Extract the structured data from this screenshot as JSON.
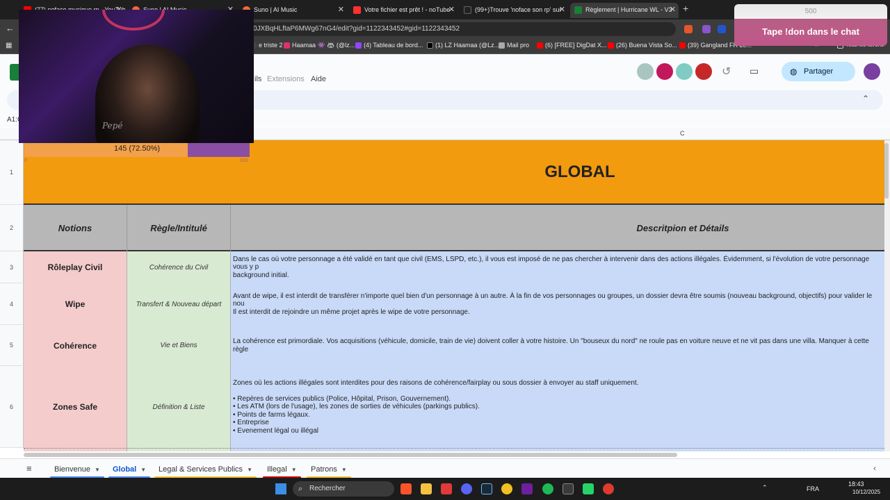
{
  "browser": {
    "tabs": [
      {
        "title": "(77) noface musique rp - YouTube",
        "color": "#ff0000"
      },
      {
        "title": "Suno | AI Music",
        "color": "#f06a3c"
      },
      {
        "title": "Suno | AI Music",
        "color": "#f06a3c"
      },
      {
        "title": "Votre fichier est prêt ! - noTube",
        "color": "#ff3030"
      },
      {
        "title": "(99+)Trouve 'noface son rp' sur",
        "color": "#222222"
      },
      {
        "title": "Règlement | Hurricane WL - V3",
        "color": "#188038"
      }
    ],
    "url": "0JXBqHLftaP6MWg67nG4/edit?gid=1122343452#gid=1122343452",
    "bookmarks": [
      {
        "label": "e triste 2",
        "color": "#444444"
      },
      {
        "label": "Haamaa 👾 🦝 (@lz...",
        "color": "#e1306c"
      },
      {
        "label": "(4) Tableau de bord...",
        "color": "#9146ff"
      },
      {
        "label": "(1) LZ Haamaa (@Lz...",
        "color": "#000000"
      },
      {
        "label": "Mail pro",
        "color": "#aaaaaa"
      },
      {
        "label": "(6) [FREE] DigDat X...",
        "color": "#ff0000"
      },
      {
        "label": "(26) Buena Vista So...",
        "color": "#ff0000"
      },
      {
        "label": "(39) Gangland FR Le...",
        "color": "#ff0000"
      }
    ],
    "all_favorites": "Tous les favoris"
  },
  "sheets": {
    "menus": [
      "ils",
      "Extensions",
      "Aide"
    ],
    "share_label": "Partager",
    "namebox": "A1:C",
    "col_c_label": "C"
  },
  "grid": {
    "title_row_num": "1",
    "title": "GLOBAL",
    "header": {
      "num": "2",
      "a": "Notions",
      "b": "Règle/Intitulé",
      "c": "Descritpion et Détails"
    },
    "rows": [
      {
        "num": "3",
        "a": "Rôleplay Civil",
        "b": "Cohérence du Civil",
        "c": "Dans le cas où votre personnage a été validé en tant que civil (EMS, LSPD, etc.), il vous est imposé de ne pas chercher à intervenir dans des actions illégales. Évidemment, si l'évolution de votre personnage vous y p\nbackground initial."
      },
      {
        "num": "4",
        "a": "Wipe",
        "b": "Transfert & Nouveau départ",
        "c": "Avant de wipe, il est interdit de transférer n'importe quel bien d'un personnage à un autre. À la fin de vos personnages ou groupes, un dossier devra être soumis (nouveau background, objectifs) pour valider le nou\nIl est interdit de rejoindre un même projet après le wipe de votre personnage."
      },
      {
        "num": "5",
        "a": "Cohérence",
        "b": "Vie et Biens",
        "c": "La cohérence est primordiale. Vos acquisitions (véhicule, domicile, train de vie) doivent coller à votre histoire. Un \"bouseux du nord\" ne roule pas en voiture neuve et ne vit pas dans une villa. Manquer à cette règle"
      },
      {
        "num": "6",
        "a": "Zones Safe",
        "b": "Définition & Liste",
        "c": "Zones où les actions illégales sont interdites pour des raisons de cohérence/fairplay ou sous dossier à envoyer au staff uniquement.\n\n• Repères de services publics (Police, Hôpital, Prison, Gouvernement).\n• Les ATM (lors de l'usage), les zones de sorties de véhicules (parkings publics).\n• Points de farms légaux.\n• Entreprise\n• Evenement légal ou illégal"
      }
    ]
  },
  "sheet_tabs": [
    {
      "label": "Bienvenue",
      "color": "#4a86e8",
      "active": false
    },
    {
      "label": "Global",
      "color": "#4a86e8",
      "active": true
    },
    {
      "label": "Legal & Services Publics",
      "color": "#f1c232",
      "active": false
    },
    {
      "label": "Illegal",
      "color": "#cc0000",
      "active": false
    },
    {
      "label": "Patrons",
      "color": "#f1c232",
      "active": false
    }
  ],
  "overlay": {
    "donate_goal": "500",
    "donate_text": "Tape !don dans le chat",
    "progress_label": "145 (72.50%)",
    "progress_fraction": 0.725,
    "progress_min": "0",
    "progress_max": "200"
  },
  "taskbar": {
    "search": "Rechercher",
    "lang": "FRA",
    "time": "18:43",
    "date": "10/12/2025"
  }
}
